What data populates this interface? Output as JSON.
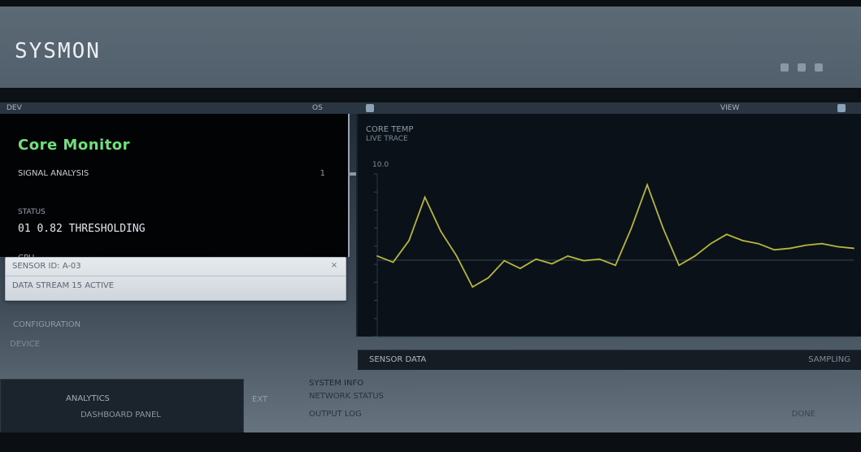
{
  "app": {
    "title": "SYSMON",
    "tabs": [
      "DEV",
      "OS",
      "VIEW"
    ],
    "window_controls": [
      "minimize",
      "maximize",
      "close"
    ]
  },
  "panel": {
    "title": "Core Monitor",
    "subtitle": "SIGNAL ANALYSIS",
    "meta": "1",
    "label": "STATUS",
    "value": "01 0.82 THRESHOLDING",
    "footer": "CPU"
  },
  "dropdown": {
    "row1": "SENSOR ID: A-03",
    "row2": "DATA STREAM 15  ACTIVE"
  },
  "chart": {
    "header": "CORE TEMP",
    "subheader": "LIVE TRACE",
    "scale_label": "10.0",
    "footer_left": "SENSOR DATA",
    "footer_right": "SAMPLING"
  },
  "lower_left": {
    "line1": "CONFIGURATION",
    "line2": "DEVICE",
    "thumb_line1": "ANALYTICS",
    "thumb_line2": "DASHBOARD PANEL",
    "small": "EXT"
  },
  "lower_right": {
    "line1": "SYSTEM INFO",
    "line2": "NETWORK STATUS",
    "line3": "OUTPUT LOG",
    "line4": "DONE"
  },
  "colors": {
    "accent": "#6fe07a",
    "chart_line": "#b6b53d",
    "panel_bg": "#020304",
    "header_bg": "#5c6a76"
  },
  "chart_data": {
    "type": "line",
    "title": "CORE TEMP",
    "xlabel": "",
    "ylabel": "",
    "x": [
      0,
      1,
      2,
      3,
      4,
      5,
      6,
      7,
      8,
      9,
      10,
      11,
      12,
      13,
      14,
      15,
      16,
      17,
      18,
      19,
      20,
      21,
      22,
      23,
      24,
      25,
      26,
      27,
      28,
      29,
      30
    ],
    "series": [
      {
        "name": "",
        "values": [
          0.52,
          0.48,
          0.62,
          0.9,
          0.68,
          0.52,
          0.32,
          0.38,
          0.49,
          0.44,
          0.5,
          0.47,
          0.52,
          0.49,
          0.5,
          0.46,
          0.7,
          0.98,
          0.7,
          0.46,
          0.52,
          0.6,
          0.66,
          0.62,
          0.6,
          0.56,
          0.57,
          0.59,
          0.6,
          0.58,
          0.57
        ]
      }
    ],
    "ylim": [
      0,
      1.05
    ],
    "grid": false,
    "legend": "none"
  }
}
